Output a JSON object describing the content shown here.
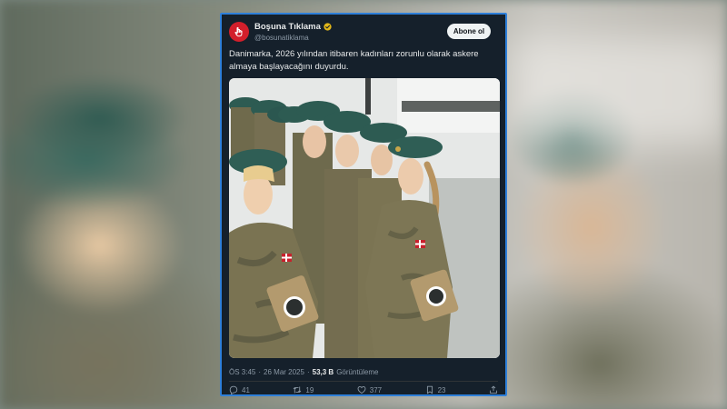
{
  "tweet": {
    "display_name": "Boşuna Tıklama",
    "handle": "@bosunatiklama",
    "follow_label": "Abone ol",
    "text": "Danimarka, 2026 yılından itibaren kadınları zorunlu olarak askere almaya başlayacağını duyurdu.",
    "time": "ÖS 3:45",
    "date": "26 Mar 2025",
    "separator": "·",
    "views_count": "53,3 B",
    "views_label": "Görüntüleme",
    "image_alt": "photo-women-soldiers-in-uniform"
  },
  "actions": {
    "replies": "41",
    "reposts": "19",
    "likes": "377",
    "bookmarks": "23"
  },
  "colors": {
    "card_bg": "#15202b",
    "card_border": "#2e7fd9",
    "avatar": "#d21f2b",
    "verified": "#e2b719",
    "beret": "#2d5b52",
    "camo": "#7b7453"
  },
  "icons": [
    "hand-cursor-icon",
    "verified-badge-icon",
    "reply-icon",
    "repost-icon",
    "like-icon",
    "bookmark-icon",
    "share-icon"
  ]
}
